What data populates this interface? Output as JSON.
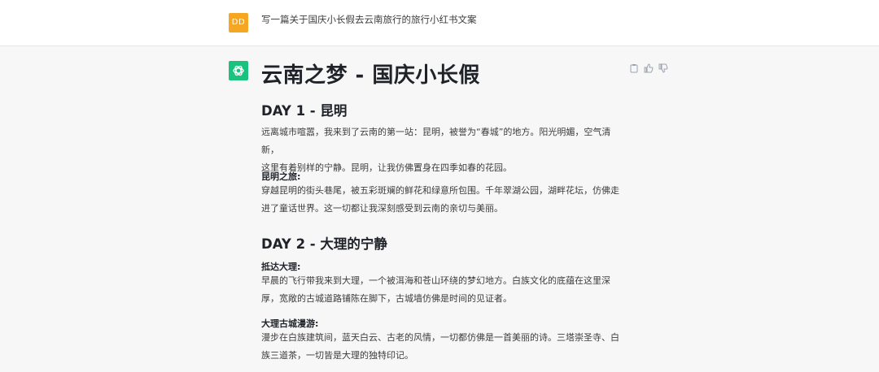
{
  "user": {
    "avatar_initials": "DD",
    "prompt": "写一篇关于国庆小长假去云南旅行的旅行小红书文案"
  },
  "assistant": {
    "title": "云南之梦 - 国庆小长假",
    "day1": {
      "heading": "DAY 1 - 昆明",
      "para1_line1": "远离城市喧嚣，我来到了云南的第一站：昆明，被誉为“春城”的地方。阳光明媚，空气清新，",
      "para1_line2": "这里有着别样的宁静。昆明，让我仿佛置身在四季如春的花园。",
      "sub1_title": "昆明之旅:",
      "sub1_line1": "穿越昆明的街头巷尾，被五彩斑斓的鲜花和绿意所包围。千年翠湖公园，湖畔花坛，仿佛走",
      "sub1_line2": "进了童话世界。这一切都让我深刻感受到云南的亲切与美丽。"
    },
    "day2": {
      "heading": "DAY 2 - 大理的宁静",
      "sub1_title": "抵达大理:",
      "sub1_line1": "早晨的飞行带我来到大理，一个被洱海和苍山环绕的梦幻地方。白族文化的底蕴在这里深",
      "sub1_line2": "厚，宽敞的古城道路铺陈在脚下，古城墙仿佛是时间的见证者。",
      "sub2_title": "大理古城漫游:",
      "sub2_line1": "漫步在白族建筑间，蓝天白云、古老的风情，一切都仿佛是一首美丽的诗。三塔崇圣寺、白",
      "sub2_line2": "族三道茶，一切皆是大理的独特印记。"
    }
  },
  "icons": {
    "assistant_avatar": "openai-logo-icon",
    "copy": "clipboard-icon",
    "thumbs_up": "thumbs-up-icon",
    "thumbs_down": "thumbs-down-icon"
  },
  "colors": {
    "user_avatar": "#f5a623",
    "assistant_avatar": "#19c37d",
    "assistant_bg": "#f7f7f8"
  }
}
